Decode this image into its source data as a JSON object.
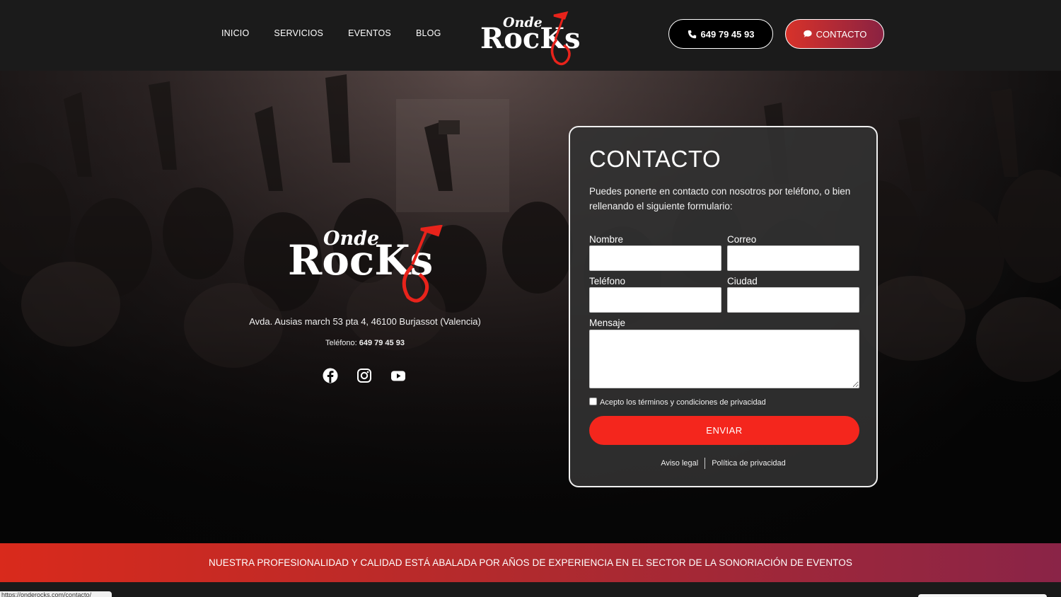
{
  "header": {
    "nav": [
      "INICIO",
      "SERVICIOS",
      "EVENTOS",
      "BLOG"
    ],
    "logo": {
      "top_word": "Onde",
      "main_word": "RocKs"
    },
    "phone_button": "649 79 45 93",
    "contact_button": "CONTACTO",
    "icons": {
      "phone": "phone-icon",
      "chat": "chat-bubble-icon"
    }
  },
  "hero": {
    "logo": {
      "top_word": "Onde",
      "main_word": "RocKs"
    },
    "address": "Avda. Ausias march 53 pta 4,  46100 Burjassot (Valencia)",
    "phone_label": "Teléfono:",
    "phone_number": "649 79 45 93",
    "socials": [
      "facebook-icon",
      "instagram-icon",
      "youtube-icon"
    ]
  },
  "form": {
    "title": "CONTACTO",
    "intro": "Puedes ponerte en contacto con nosotros por teléfono, o bien rellenando el siguiente formulario:",
    "labels": {
      "nombre": "Nombre",
      "correo": "Correo",
      "telefono": "Teléfono",
      "ciudad": "Ciudad",
      "mensaje": "Mensaje"
    },
    "values": {
      "nombre": "",
      "correo": "",
      "telefono": "",
      "ciudad": "",
      "mensaje": ""
    },
    "terms": "Acepto los términos y condiciones de privacidad",
    "terms_checked": false,
    "submit": "ENVIAR",
    "legal_links": [
      "Aviso legal",
      "Política de privacidad"
    ]
  },
  "banner": "NUESTRA PROFESIONALIDAD Y CALIDAD ESTÁ ABALADA POR AÑOS DE EXPERIENCIA EN EL SECTOR DE LA SONORIACIÓN DE EVENTOS",
  "status_bar_url": "https://onderocks.com/contacto/",
  "colors": {
    "header_bg": "#1b1b1b",
    "accent_red": "#f4261d",
    "gradient_start": "#d8322a",
    "gradient_end": "#8a2242",
    "card_bg": "#323232"
  }
}
